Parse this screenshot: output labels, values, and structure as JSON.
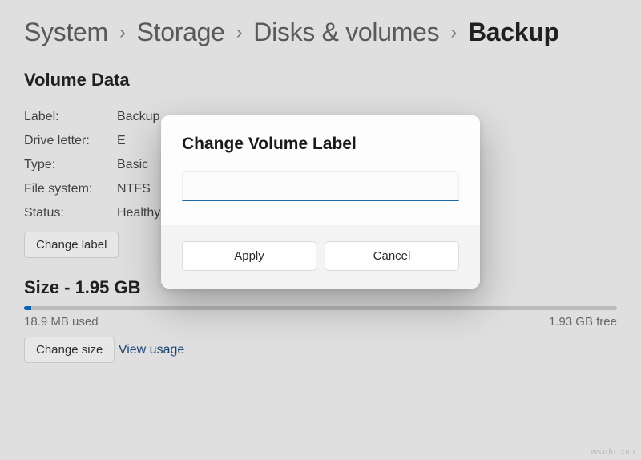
{
  "breadcrumb": {
    "system": "System",
    "storage": "Storage",
    "disks": "Disks & volumes",
    "current": "Backup"
  },
  "section": {
    "volume_data_title": "Volume Data",
    "fields": {
      "label_key": "Label:",
      "label_val": "Backup",
      "drive_key": "Drive letter:",
      "drive_val": "E",
      "type_key": "Type:",
      "type_val": "Basic",
      "fs_key": "File system:",
      "fs_val": "NTFS",
      "status_key": "Status:",
      "status_val": "Healthy"
    },
    "change_label_btn": "Change label"
  },
  "size": {
    "header": "Size - 1.95 GB",
    "used": "18.9 MB used",
    "free": "1.93 GB free",
    "change_size_btn": "Change size",
    "view_usage": "View usage"
  },
  "modal": {
    "title": "Change Volume Label",
    "input_value": "",
    "apply": "Apply",
    "cancel": "Cancel"
  },
  "watermark": "wsxdn.com"
}
